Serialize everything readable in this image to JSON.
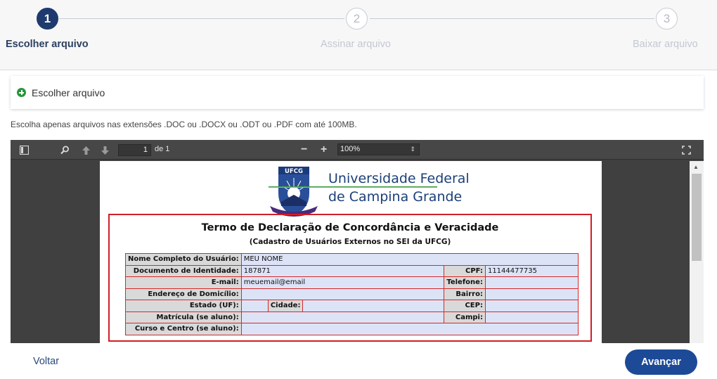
{
  "stepper": {
    "steps": [
      {
        "number": "1",
        "label": "Escolher arquivo"
      },
      {
        "number": "2",
        "label": "Assinar arquivo"
      },
      {
        "number": "3",
        "label": "Baixar arquivo"
      }
    ]
  },
  "upload": {
    "button_label": "Escolher arquivo",
    "hint": "Escolha apenas arquivos nas extensões .DOC ou .DOCX ou .ODT ou .PDF com até 100MB."
  },
  "viewer": {
    "page_number": "1",
    "page_of": "de 1",
    "zoom": "100%"
  },
  "document": {
    "logo_text": "UFCG",
    "university_line1": "Universidade Federal",
    "university_line2": "de Campina Grande",
    "title": "Termo de Declaração de Concordância e Veracidade",
    "subtitle": "(Cadastro de Usuários Externos no SEI da UFCG)",
    "fields": {
      "nome_label": "Nome Completo do Usuário:",
      "nome_value": "MEU NOME",
      "doc_label": "Documento de Identidade:",
      "doc_value": "187871",
      "cpf_label": "CPF:",
      "cpf_value": "11144477735",
      "email_label": "E-mail:",
      "email_value": "meuemail@email",
      "telefone_label": "Telefone:",
      "endereco_label": "Endereço de Domicílio:",
      "bairro_label": "Bairro:",
      "estado_label": "Estado (UF):",
      "cidade_label": "Cidade:",
      "cep_label": "CEP:",
      "matricula_label": "Matrícula (se aluno):",
      "campi_label": "Campi:",
      "curso_label": "Curso e Centro (se aluno):"
    }
  },
  "footer": {
    "back_label": "Voltar",
    "next_label": "Avançar"
  },
  "colors": {
    "primary": "#1d4a96",
    "step_active": "#1e3a6e",
    "success": "#27953a",
    "doc_border": "#d01f26"
  }
}
